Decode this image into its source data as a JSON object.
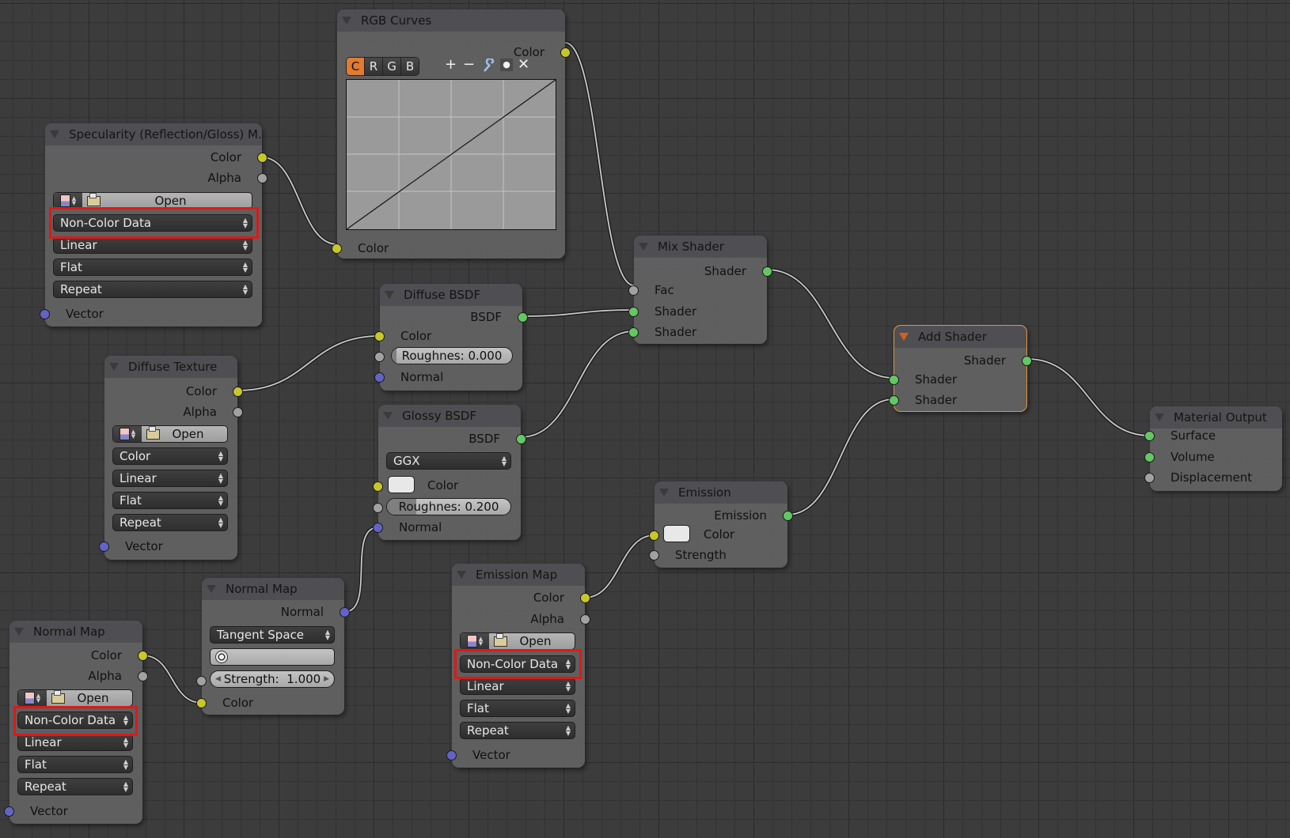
{
  "colors": {
    "socket_color": "#c7c729",
    "socket_shader": "#63c763",
    "socket_value": "#a1a1a1",
    "socket_vector": "#6363c7",
    "active_node_border": "#e8913a",
    "highlight_box": "#e01818",
    "curve_channel_active": "#e27a30"
  },
  "nodes": {
    "rgb_curves": {
      "title": "RGB Curves",
      "output": "Color",
      "channels": [
        "C",
        "R",
        "G",
        "B"
      ],
      "active_channel": "C",
      "tools": [
        "plus-icon",
        "minus-icon",
        "wrench-icon",
        "dot-icon",
        "close-icon"
      ],
      "tool_glyphs": [
        "+",
        "−",
        "🔧",
        "●",
        "✕"
      ],
      "input": "Color"
    },
    "specularity": {
      "title": "Specularity (Reflection/Gloss) M...",
      "outputs": [
        "Color",
        "Alpha"
      ],
      "open_label": "Open",
      "color_space": "Non-Color Data",
      "interpolation": "Linear",
      "projection": "Flat",
      "extension": "Repeat",
      "input": "Vector"
    },
    "diffuse_bsdf": {
      "title": "Diffuse BSDF",
      "output": "BSDF",
      "color_label": "Color",
      "roughness_label": "Roughnes: 0.000",
      "roughness_value": 0.0,
      "normal_label": "Normal"
    },
    "glossy_bsdf": {
      "title": "Glossy BSDF",
      "output": "BSDF",
      "distribution": "GGX",
      "color_label": "Color",
      "roughness_label": "Roughnes: 0.200",
      "roughness_value": 0.2,
      "normal_label": "Normal"
    },
    "diffuse_texture": {
      "title": "Diffuse Texture",
      "outputs": [
        "Color",
        "Alpha"
      ],
      "open_label": "Open",
      "color_space": "Color",
      "interpolation": "Linear",
      "projection": "Flat",
      "extension": "Repeat",
      "input": "Vector"
    },
    "mix_shader": {
      "title": "Mix Shader",
      "output": "Shader",
      "inputs": [
        "Fac",
        "Shader",
        "Shader"
      ]
    },
    "add_shader": {
      "title": "Add Shader",
      "output": "Shader",
      "inputs": [
        "Shader",
        "Shader"
      ]
    },
    "material_output": {
      "title": "Material Output",
      "inputs": [
        "Surface",
        "Volume",
        "Displacement"
      ]
    },
    "emission": {
      "title": "Emission",
      "output": "Emission",
      "color_label": "Color",
      "strength_label": "Strength"
    },
    "emission_map": {
      "title": "Emission Map",
      "outputs": [
        "Color",
        "Alpha"
      ],
      "open_label": "Open",
      "color_space": "Non-Color Data",
      "interpolation": "Linear",
      "projection": "Flat",
      "extension": "Repeat",
      "input": "Vector"
    },
    "normal_map_node": {
      "title": "Normal Map",
      "output": "Normal",
      "space": "Tangent Space",
      "strength_label": "Strength:",
      "strength_value": "1.000",
      "input": "Color"
    },
    "normal_map_texture": {
      "title": "Normal Map",
      "outputs": [
        "Color",
        "Alpha"
      ],
      "open_label": "Open",
      "color_space": "Non-Color Data",
      "interpolation": "Linear",
      "projection": "Flat",
      "extension": "Repeat",
      "input": "Vector"
    }
  }
}
